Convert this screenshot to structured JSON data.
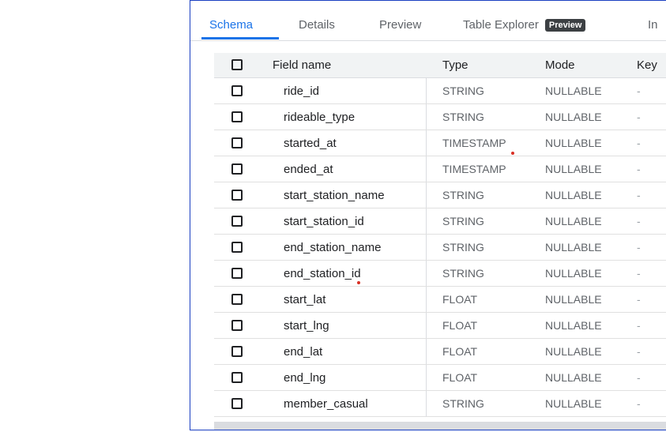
{
  "tabs": [
    {
      "label": "Schema",
      "active": true
    },
    {
      "label": "Details"
    },
    {
      "label": "Preview"
    },
    {
      "label": "Table Explorer",
      "badge": "Preview"
    },
    {
      "label": "In"
    }
  ],
  "schema": {
    "headers": {
      "name": "Field name",
      "type": "Type",
      "mode": "Mode",
      "key": "Key"
    },
    "rows": [
      {
        "name": "ride_id",
        "type": "STRING",
        "mode": "NULLABLE",
        "key": "-"
      },
      {
        "name": "rideable_type",
        "type": "STRING",
        "mode": "NULLABLE",
        "key": "-"
      },
      {
        "name": "started_at",
        "type": "TIMESTAMP",
        "mode": "NULLABLE",
        "key": "-"
      },
      {
        "name": "ended_at",
        "type": "TIMESTAMP",
        "mode": "NULLABLE",
        "key": "-"
      },
      {
        "name": "start_station_name",
        "type": "STRING",
        "mode": "NULLABLE",
        "key": "-"
      },
      {
        "name": "start_station_id",
        "type": "STRING",
        "mode": "NULLABLE",
        "key": "-"
      },
      {
        "name": "end_station_name",
        "type": "STRING",
        "mode": "NULLABLE",
        "key": "-"
      },
      {
        "name": "end_station_id",
        "type": "STRING",
        "mode": "NULLABLE",
        "key": "-"
      },
      {
        "name": "start_lat",
        "type": "FLOAT",
        "mode": "NULLABLE",
        "key": "-"
      },
      {
        "name": "start_lng",
        "type": "FLOAT",
        "mode": "NULLABLE",
        "key": "-"
      },
      {
        "name": "end_lat",
        "type": "FLOAT",
        "mode": "NULLABLE",
        "key": "-"
      },
      {
        "name": "end_lng",
        "type": "FLOAT",
        "mode": "NULLABLE",
        "key": "-"
      },
      {
        "name": "member_casual",
        "type": "STRING",
        "mode": "NULLABLE",
        "key": "-"
      }
    ]
  },
  "colors": {
    "accent": "#1a73e8",
    "frame": "#1a3fc2",
    "marker": "#d93025"
  }
}
